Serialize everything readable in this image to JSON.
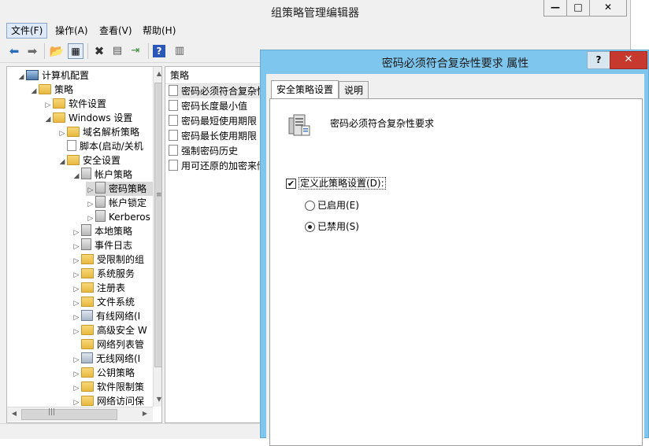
{
  "window": {
    "title": "组策略管理编辑器",
    "minimize": "—",
    "maximize": "□",
    "close": "✕"
  },
  "menu": {
    "file": "文件(F)",
    "action": "操作(A)",
    "view": "查看(V)",
    "help": "帮助(H)"
  },
  "tree": {
    "items": [
      {
        "label": "计算机配置"
      },
      {
        "label": "策略"
      },
      {
        "label": "软件设置"
      },
      {
        "label": "Windows 设置"
      },
      {
        "label": "域名解析策略"
      },
      {
        "label": "脚本(启动/关机"
      },
      {
        "label": "安全设置"
      },
      {
        "label": "帐户策略"
      },
      {
        "label": "密码策略"
      },
      {
        "label": "帐户锁定"
      },
      {
        "label": "Kerberos"
      },
      {
        "label": "本地策略"
      },
      {
        "label": "事件日志"
      },
      {
        "label": "受限制的组"
      },
      {
        "label": "系统服务"
      },
      {
        "label": "注册表"
      },
      {
        "label": "文件系统"
      },
      {
        "label": "有线网络(I"
      },
      {
        "label": "高级安全 W"
      },
      {
        "label": "网络列表管"
      },
      {
        "label": "无线网络(I"
      },
      {
        "label": "公钥策略"
      },
      {
        "label": "软件限制策"
      },
      {
        "label": "网络访问保"
      }
    ]
  },
  "list": {
    "header": "策略",
    "rows": [
      {
        "label": "密码必须符合复杂性"
      },
      {
        "label": "密码长度最小值"
      },
      {
        "label": "密码最短使用期限"
      },
      {
        "label": "密码最长使用期限"
      },
      {
        "label": "强制密码历史"
      },
      {
        "label": "用可还原的加密来储"
      }
    ]
  },
  "dialog": {
    "title": "密码必须符合复杂性要求 属性",
    "help": "?",
    "close": "✕",
    "tabs": {
      "security": "安全策略设置",
      "explain": "说明"
    },
    "policy_name": "密码必须符合复杂性要求",
    "define_label": "定义此策略设置(D):",
    "define_checked": true,
    "enabled_label": "已启用(E)",
    "disabled_label": "已禁用(S)",
    "selected": "disabled"
  }
}
